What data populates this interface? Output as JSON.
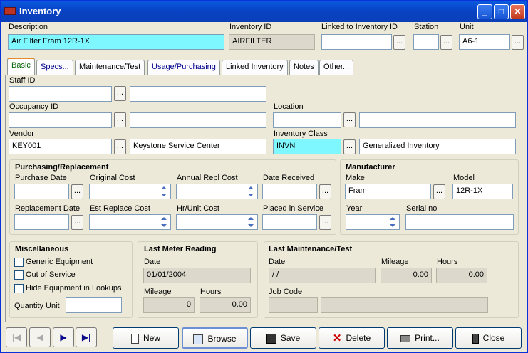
{
  "window": {
    "title": "Inventory"
  },
  "header": {
    "description_label": "Description",
    "description_value": "Air Filter Fram 12R-1X",
    "inventory_id_label": "Inventory ID",
    "inventory_id_value": "AIRFILTER",
    "linked_label": "Linked to Inventory ID",
    "linked_value": "",
    "station_label": "Station",
    "station_value": "",
    "unit_label": "Unit",
    "unit_value": "A6-1"
  },
  "tabs": [
    "Basic",
    "Specs...",
    "Maintenance/Test",
    "Usage/Purchasing",
    "Linked Inventory",
    "Notes",
    "Other..."
  ],
  "basic": {
    "staff_label": "Staff ID",
    "staff_value": "",
    "staff_desc": "",
    "occupancy_label": "Occupancy ID",
    "occupancy_value": "",
    "occupancy_desc": "",
    "location_label": "Location",
    "location_value": "",
    "location_desc": "",
    "vendor_label": "Vendor",
    "vendor_value": "KEY001",
    "vendor_desc": "Keystone Service Center",
    "class_label": "Inventory Class",
    "class_value": "INVN",
    "class_desc": "Generalized Inventory"
  },
  "purchasing": {
    "title": "Purchasing/Replacement",
    "purchase_date": "Purchase Date",
    "original_cost": "Original Cost",
    "annual_repl_cost": "Annual Repl Cost",
    "date_received": "Date Received",
    "replacement_date": "Replacement Date",
    "est_replace_cost": "Est Replace Cost",
    "hr_unit_cost": "Hr/Unit Cost",
    "placed_in_service": "Placed in Service"
  },
  "manufacturer": {
    "title": "Manufacturer",
    "make_label": "Make",
    "make_value": "Fram",
    "model_label": "Model",
    "model_value": "12R-1X",
    "year_label": "Year",
    "serial_label": "Serial no"
  },
  "misc": {
    "title": "Miscellaneous",
    "generic": "Generic Equipment",
    "out_of_service": "Out of Service",
    "hide": "Hide Equipment in Lookups",
    "quantity_unit": "Quantity Unit"
  },
  "meter": {
    "title": "Last Meter Reading",
    "date_label": "Date",
    "date_value": "01/01/2004",
    "mileage_label": "Mileage",
    "mileage_value": "0",
    "hours_label": "Hours",
    "hours_value": "0.00"
  },
  "maintenance": {
    "title": "Last Maintenance/Test",
    "date_label": "Date",
    "date_value": " / /",
    "mileage_label": "Mileage",
    "mileage_value": "0.00",
    "hours_label": "Hours",
    "hours_value": "0.00",
    "job_code_label": "Job Code"
  },
  "buttons": {
    "new": "New",
    "browse": "Browse",
    "save": "Save",
    "delete": "Delete",
    "print": "Print...",
    "close": "Close"
  },
  "icons": [
    "minimize-icon",
    "maximize-icon",
    "close-icon",
    "first-record-icon",
    "prev-record-icon",
    "next-record-icon",
    "last-record-icon"
  ]
}
